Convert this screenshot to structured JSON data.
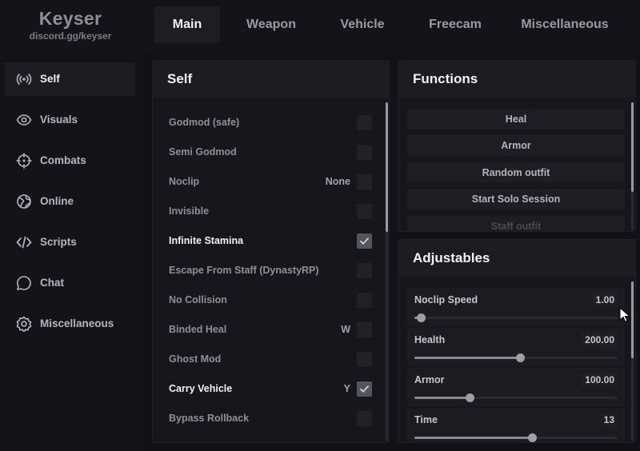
{
  "app": {
    "title": "Keyser",
    "subtitle": "discord.gg/keyser"
  },
  "tabs": [
    {
      "label": "Main",
      "active": true
    },
    {
      "label": "Weapon",
      "active": false
    },
    {
      "label": "Vehicle",
      "active": false
    },
    {
      "label": "Freecam",
      "active": false
    },
    {
      "label": "Miscellaneous",
      "active": false
    }
  ],
  "sidebar": {
    "items": [
      {
        "label": "Self",
        "icon": "broadcast-icon",
        "active": true
      },
      {
        "label": "Visuals",
        "icon": "eye-icon",
        "active": false
      },
      {
        "label": "Combats",
        "icon": "crosshair-icon",
        "active": false
      },
      {
        "label": "Online",
        "icon": "globe-icon",
        "active": false
      },
      {
        "label": "Scripts",
        "icon": "code-icon",
        "active": false
      },
      {
        "label": "Chat",
        "icon": "chat-bubble-icon",
        "active": false
      },
      {
        "label": "Miscellaneous",
        "icon": "gear-icon",
        "active": false
      }
    ]
  },
  "self_panel": {
    "title": "Self",
    "options": [
      {
        "label": "Godmod (safe)",
        "key": "",
        "checked": false
      },
      {
        "label": "Semi Godmod",
        "key": "",
        "checked": false
      },
      {
        "label": "Noclip",
        "key": "None",
        "checked": false
      },
      {
        "label": "Invisible",
        "key": "",
        "checked": false
      },
      {
        "label": "Infinite Stamina",
        "key": "",
        "checked": true
      },
      {
        "label": "Escape From Staff (DynastyRP)",
        "key": "",
        "checked": false
      },
      {
        "label": "No Collision",
        "key": "",
        "checked": false
      },
      {
        "label": "Binded Heal",
        "key": "W",
        "checked": false
      },
      {
        "label": "Ghost Mod",
        "key": "",
        "checked": false
      },
      {
        "label": "Carry Vehicle",
        "key": "Y",
        "checked": true
      },
      {
        "label": "Bypass Rollback",
        "key": "",
        "checked": false
      }
    ]
  },
  "functions_panel": {
    "title": "Functions",
    "buttons": [
      {
        "label": "Heal"
      },
      {
        "label": "Armor"
      },
      {
        "label": "Random outfit"
      },
      {
        "label": "Start Solo Session"
      },
      {
        "label": "Staff outfit"
      }
    ]
  },
  "adjustables_panel": {
    "title": "Adjustables",
    "sliders": [
      {
        "label": "Noclip Speed",
        "value": "1.00",
        "fraction": 0.03
      },
      {
        "label": "Health",
        "value": "200.00",
        "fraction": 0.52
      },
      {
        "label": "Armor",
        "value": "100.00",
        "fraction": 0.27
      },
      {
        "label": "Time",
        "value": "13",
        "fraction": 0.58
      }
    ]
  },
  "colors": {
    "background": "#121216",
    "panel": "#17171b",
    "panel_header": "#1c1c21",
    "text_primary": "#f2f2f4",
    "text_muted": "#8f8f96",
    "checkbox_on": "#55555c"
  }
}
